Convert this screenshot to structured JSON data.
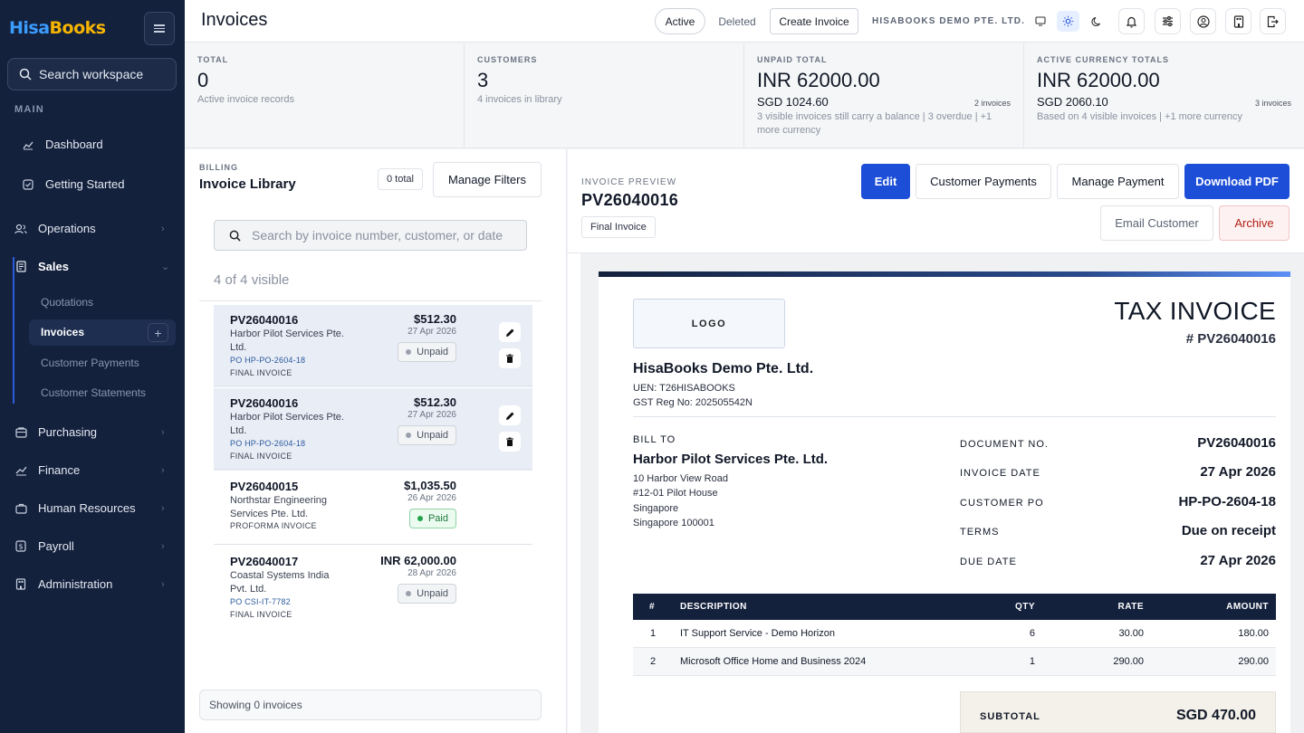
{
  "app": {
    "logo_left": "Hisa",
    "logo_right": "Books"
  },
  "sidebar": {
    "search_label": "Search workspace",
    "section": "MAIN",
    "items": [
      {
        "label": "Dashboard"
      },
      {
        "label": "Getting Started"
      },
      {
        "label": "Operations"
      },
      {
        "label": "Sales"
      },
      {
        "label": "Purchasing"
      },
      {
        "label": "Finance"
      },
      {
        "label": "Human Resources"
      },
      {
        "label": "Payroll"
      },
      {
        "label": "Administration"
      }
    ],
    "sales_sub": [
      {
        "label": "Quotations"
      },
      {
        "label": "Invoices"
      },
      {
        "label": "Customer Payments"
      },
      {
        "label": "Customer Statements"
      }
    ]
  },
  "header": {
    "title": "Invoices",
    "active_label": "Active",
    "deleted_label": "Deleted",
    "create_label": "Create Invoice",
    "company": "HISABOOKS DEMO PTE. LTD."
  },
  "stats": [
    {
      "label": "TOTAL",
      "value": "0",
      "sub": "Active invoice records"
    },
    {
      "label": "CUSTOMERS",
      "value": "3",
      "sub": "4 invoices in library"
    },
    {
      "label": "UNPAID TOTAL",
      "value": "INR 62000.00",
      "secondary": "SGD 1024.60",
      "count": "2 invoices",
      "note": "3 visible invoices still carry a balance | 3 overdue | +1 more currency"
    },
    {
      "label": "ACTIVE CURRENCY TOTALS",
      "value": "INR 62000.00",
      "secondary": "SGD 2060.10",
      "count": "3 invoices",
      "note": "Based on 4 visible invoices | +1 more currency"
    }
  ],
  "library": {
    "kicker": "BILLING",
    "title": "Invoice Library",
    "total": "0 total",
    "manage_filters": "Manage Filters",
    "search_placeholder": "Search by invoice number, customer, or date",
    "visible": "4 of 4 visible",
    "invoices": [
      {
        "number": "PV26040016",
        "customer": "Harbor Pilot Services Pte. Ltd.",
        "po": "PO HP-PO-2604-18",
        "kind": "FINAL INVOICE",
        "amount": "$512.30",
        "date": "27 Apr 2026",
        "status": "Unpaid"
      },
      {
        "number": "PV26040016",
        "customer": "Harbor Pilot Services Pte. Ltd.",
        "po": "PO HP-PO-2604-18",
        "kind": "FINAL INVOICE",
        "amount": "$512.30",
        "date": "27 Apr 2026",
        "status": "Unpaid"
      },
      {
        "number": "PV26040015",
        "customer": "Northstar Engineering Services Pte. Ltd.",
        "po": "",
        "kind": "PROFORMA INVOICE",
        "amount": "$1,035.50",
        "date": "26 Apr 2026",
        "status": "Paid"
      },
      {
        "number": "PV26040017",
        "customer": "Coastal Systems India Pvt. Ltd.",
        "po": "PO CSI-IT-7782",
        "kind": "FINAL INVOICE",
        "amount": "INR 62,000.00",
        "date": "28 Apr 2026",
        "status": "Unpaid"
      }
    ],
    "showing": "Showing 0 invoices"
  },
  "preview": {
    "kicker": "INVOICE PREVIEW",
    "number": "PV26040016",
    "tag": "Final Invoice",
    "buttons": {
      "edit": "Edit",
      "customer_payments": "Customer Payments",
      "manage_payment": "Manage Payment",
      "download": "Download PDF",
      "email": "Email Customer",
      "archive": "Archive"
    }
  },
  "document": {
    "logo": "LOGO",
    "heading": "TAX INVOICE",
    "doc_number": "# PV26040016",
    "company": "HisaBooks Demo Pte. Ltd.",
    "uen": "UEN: T26HISABOOKS",
    "gst": "GST Reg No: 202505542N",
    "bill_to_label": "BILL TO",
    "bill_to_name": "Harbor Pilot Services Pte. Ltd.",
    "address": [
      "10 Harbor View Road",
      "#12-01 Pilot House",
      "Singapore",
      "Singapore 100001"
    ],
    "meta": [
      {
        "k": "DOCUMENT NO.",
        "v": "PV26040016"
      },
      {
        "k": "INVOICE DATE",
        "v": "27 Apr 2026"
      },
      {
        "k": "CUSTOMER PO",
        "v": "HP-PO-2604-18"
      },
      {
        "k": "TERMS",
        "v": "Due on receipt"
      },
      {
        "k": "DUE DATE",
        "v": "27 Apr 2026"
      }
    ],
    "columns": {
      "num": "#",
      "desc": "DESCRIPTION",
      "qty": "QTY",
      "rate": "RATE",
      "amount": "AMOUNT"
    },
    "lines": [
      {
        "num": "1",
        "desc": "IT Support Service - Demo Horizon",
        "qty": "6",
        "rate": "30.00",
        "amount": "180.00"
      },
      {
        "num": "2",
        "desc": "Microsoft Office Home and Business 2024",
        "qty": "1",
        "rate": "290.00",
        "amount": "290.00"
      }
    ],
    "subtotal_label": "SUBTOTAL",
    "subtotal_value": "SGD 470.00"
  },
  "colors": {
    "sidebar": "#14213d",
    "primary": "#1d4ed8",
    "paid": "#22a34b",
    "danger": "#b42318"
  }
}
